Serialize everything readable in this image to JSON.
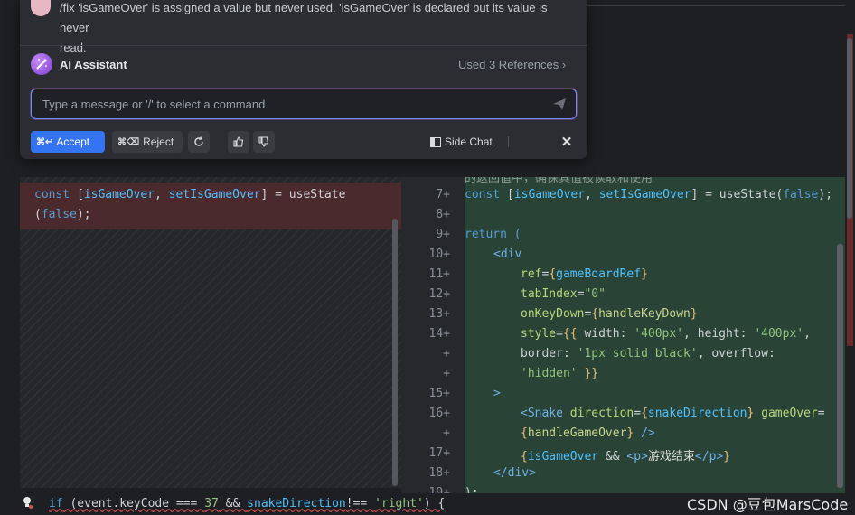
{
  "ai_panel": {
    "prompt_line1": "/fix 'isGameOver' is assigned a value but never used. 'isGameOver' is declared but its value is never",
    "prompt_line2": "read.",
    "assistant_name": "AI Assistant",
    "references": "Used 3 References",
    "input_placeholder": "Type a message or '/' to select a command",
    "accept_label": "Accept",
    "accept_shortcut": "⌘↩",
    "reject_label": "Reject",
    "reject_shortcut": "⌘⌫",
    "side_chat_label": "Side Chat",
    "close_symbol": "✕"
  },
  "left_diff": {
    "line1": "const [isGameOver, setIsGameOver] = useState",
    "line2": "(false);"
  },
  "gutter": {
    "lines": [
      "7+",
      "8+",
      "9+",
      "10+",
      "11+",
      "12+",
      "13+",
      "14+",
      "+",
      "+",
      "15+",
      "16+",
      "+",
      "17+",
      "18+",
      "19+"
    ]
  },
  "right_diff": {
    "comment_partial": "的返回值中，确保其值被读取和使用",
    "l7": "const [isGameOver, setIsGameOver] = useState(false);",
    "l9": "return (",
    "l10": "<div",
    "l11": "ref={gameBoardRef}",
    "l12": "tabIndex=\"0\"",
    "l13": "onKeyDown={handleKeyDown}",
    "l14": "style={{ width: '400px', height: '400px',",
    "l14b": "border: '1px solid black', overflow:",
    "l14c": "'hidden' }}",
    "l15": ">",
    "l16": "<Snake direction={snakeDirection} gameOver=",
    "l16b": "{handleGameOver} />",
    "l17": "{isGameOver && <p>游戏结束</p>}",
    "l18": "</div>",
    "l19": ");"
  },
  "bottom": {
    "code": "if (event.keyCode === 37 && snakeDirection!== 'right') {",
    "watermark": "CSDN @豆包MarsCode"
  },
  "icons": {
    "assistant": "ai-assistant-icon",
    "send": "send-icon",
    "refresh": "refresh-icon",
    "thumbs_up": "thumbs-up-icon",
    "thumbs_down": "thumbs-down-icon",
    "side_chat": "side-panel-icon",
    "bulb": "lightbulb-icon"
  },
  "colors": {
    "accept": "#3574f0",
    "added_bg": "#294436",
    "removed_bg": "#4a2a2d",
    "panel_bg": "#2b2d33"
  }
}
